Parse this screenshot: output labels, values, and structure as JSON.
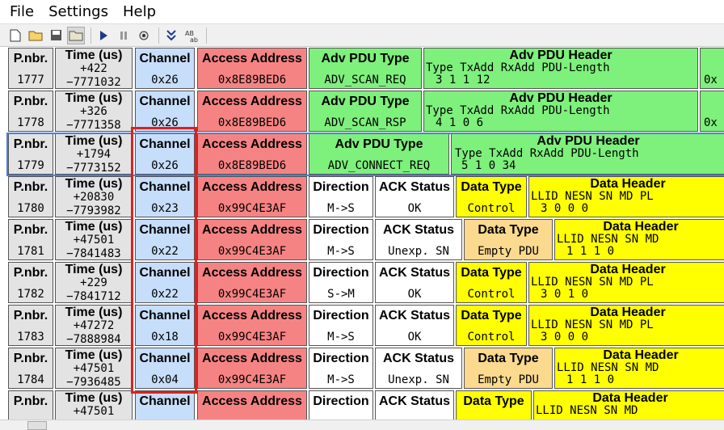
{
  "menu": {
    "file": "File",
    "settings": "Settings",
    "help": "Help"
  },
  "toolbar_icons": [
    "new-file-icon",
    "open-folder-icon",
    "save-icon",
    "open-dir-icon",
    "play-icon",
    "pause-icon",
    "settings-icon",
    "scroll-down-icon",
    "text-ab-icon"
  ],
  "colors": {
    "channel": "#c7defb",
    "access": "#f68383",
    "pdu": "#7ef07c",
    "data": "#ffff00",
    "empty": "#fbd98e",
    "gray": "#e3e3e3",
    "highlight": "#e02020"
  },
  "rows": [
    {
      "pn": "P.nbr.",
      "pn_val": "1777",
      "time_h": "Time (us)",
      "time_v": "+422",
      "time_v2": "−7771032",
      "ch_h": "Channel",
      "ch_v": "0x26",
      "aa_h": "Access Address",
      "aa_v": "0x8E89BED6",
      "pdu_h": "Adv PDU Type",
      "pdu_v": "ADV_SCAN_REQ",
      "hdr_h": "Adv PDU Header",
      "hdr_l": "Type  TxAdd  RxAdd  PDU-Length",
      "hdr_v": "3       1       1        12",
      "extra": "0x"
    },
    {
      "pn": "P.nbr.",
      "pn_val": "1778",
      "time_h": "Time (us)",
      "time_v": "+326",
      "time_v2": "−7771358",
      "ch_h": "Channel",
      "ch_v": "0x26",
      "aa_h": "Access Address",
      "aa_v": "0x8E89BED6",
      "pdu_h": "Adv PDU Type",
      "pdu_v": "ADV_SCAN_RSP",
      "hdr_h": "Adv PDU Header",
      "hdr_l": "Type  TxAdd  RxAdd  PDU-Length",
      "hdr_v": "4       1       0         6",
      "extra": "0x"
    },
    {
      "pn": "P.nbr.",
      "pn_val": "1779",
      "time_h": "Time (us)",
      "time_v": "+1794",
      "time_v2": "−7773152",
      "ch_h": "Channel",
      "ch_v": "0x26",
      "aa_h": "Access Address",
      "aa_v": "0x8E89BED6",
      "pdu_h": "Adv PDU Type",
      "pdu_v": "ADV_CONNECT_REQ",
      "hdr_h": "Adv PDU Header",
      "hdr_l": "Type   TxAdd   RxAdd   PDU-Length",
      "hdr_v": "5        1        0         34"
    },
    {
      "pn": "P.nbr.",
      "pn_val": "1780",
      "time_h": "Time (us)",
      "time_v": "+20830",
      "time_v2": "−7793982",
      "ch_h": "Channel",
      "ch_v": "0x23",
      "aa_h": "Access Address",
      "aa_v": "0x99C4E3AF",
      "dir_h": "Direction",
      "dir_v": "M->S",
      "ack_h": "ACK Status",
      "ack_v": "OK",
      "dt_h": "Data Type",
      "dt_v": "Control",
      "dh_h": "Data Header",
      "dh_l": "LLID  NESN  SN  MD  PL",
      "dh_v": "3       0      0    0"
    },
    {
      "pn": "P.nbr.",
      "pn_val": "1781",
      "time_h": "Time (us)",
      "time_v": "+47501",
      "time_v2": "−7841483",
      "ch_h": "Channel",
      "ch_v": "0x22",
      "aa_h": "Access Address",
      "aa_v": "0x99C4E3AF",
      "dir_h": "Direction",
      "dir_v": "M->S",
      "ack_h": "ACK Status",
      "ack_v": "Unexp. SN",
      "dt_h": "Data Type",
      "dt_v": "Empty PDU",
      "dh_h": "Data Header",
      "dh_l": "LLID  NESN  SN  MD",
      "dh_v": "1       1      1    0"
    },
    {
      "pn": "P.nbr.",
      "pn_val": "1782",
      "time_h": "Time (us)",
      "time_v": "+229",
      "time_v2": "−7841712",
      "ch_h": "Channel",
      "ch_v": "0x22",
      "aa_h": "Access Address",
      "aa_v": "0x99C4E3AF",
      "dir_h": "Direction",
      "dir_v": "S->M",
      "ack_h": "ACK Status",
      "ack_v": "OK",
      "dt_h": "Data Type",
      "dt_v": "Control",
      "dh_h": "Data Header",
      "dh_l": "LLID  NESN  SN  MD  PL",
      "dh_v": "3       0      1    0"
    },
    {
      "pn": "P.nbr.",
      "pn_val": "1783",
      "time_h": "Time (us)",
      "time_v": "+47272",
      "time_v2": "−7888984",
      "ch_h": "Channel",
      "ch_v": "0x18",
      "aa_h": "Access Address",
      "aa_v": "0x99C4E3AF",
      "dir_h": "Direction",
      "dir_v": "M->S",
      "ack_h": "ACK Status",
      "ack_v": "OK",
      "dt_h": "Data Type",
      "dt_v": "Control",
      "dh_h": "Data Header",
      "dh_l": "LLID  NESN  SN  MD  PL",
      "dh_v": "3       0      0    0"
    },
    {
      "pn": "P.nbr.",
      "pn_val": "1784",
      "time_h": "Time (us)",
      "time_v": "+47501",
      "time_v2": "−7936485",
      "ch_h": "Channel",
      "ch_v": "0x04",
      "aa_h": "Access Address",
      "aa_v": "0x99C4E3AF",
      "dir_h": "Direction",
      "dir_v": "M->S",
      "ack_h": "ACK Status",
      "ack_v": "Unexp. SN",
      "dt_h": "Data Type",
      "dt_v": "Empty PDU",
      "dh_h": "Data Header",
      "dh_l": "LLID  NESN  SN  MD",
      "dh_v": "1       1      1    0"
    },
    {
      "pn": "P.nbr.",
      "pn_val": "",
      "time_h": "Time (us)",
      "time_v": "+47501",
      "time_v2": "",
      "ch_h": "Channel",
      "ch_v": "",
      "aa_h": "Access Address",
      "aa_v": "",
      "dir_h": "Direction",
      "dir_v": "",
      "ack_h": "ACK Status",
      "ack_v": "",
      "dt_h": "Data Type",
      "dt_v": "",
      "dh_h": "Data Header",
      "dh_l": "LLID  NESN  SN  MD",
      "dh_v": ""
    }
  ]
}
